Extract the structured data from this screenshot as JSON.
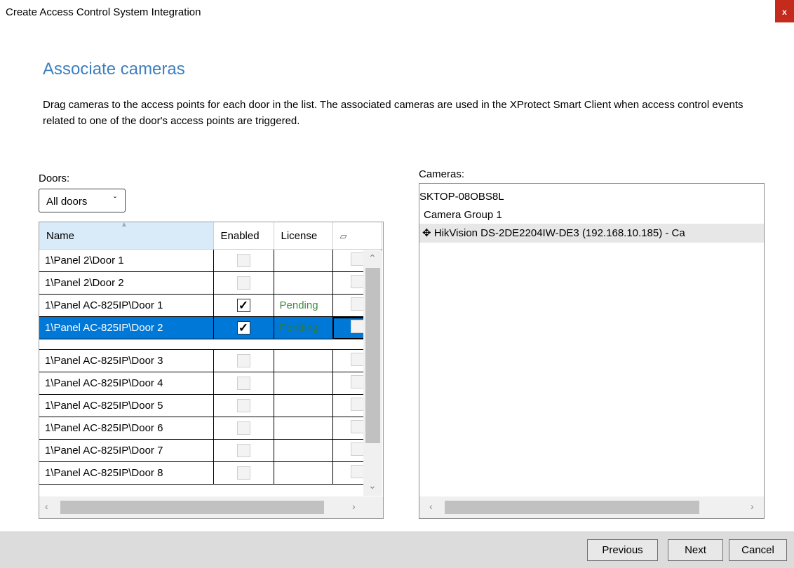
{
  "window": {
    "title": "Create Access Control System Integration",
    "close_label": "x"
  },
  "page": {
    "heading": "Associate cameras",
    "description": "Drag cameras to the access points for each door in the list. The associated cameras are used in the XProtect Smart Client when access control events related to one of the door's access points are triggered."
  },
  "doors": {
    "label": "Doors:",
    "filter": {
      "selected": "All doors"
    },
    "columns": [
      "Name",
      "Enabled",
      "License"
    ],
    "rows": [
      {
        "name": "1\\Panel 2\\Door 1",
        "enabled": false,
        "license": ""
      },
      {
        "name": "1\\Panel 2\\Door 2",
        "enabled": false,
        "license": ""
      },
      {
        "name": "1\\Panel AC-825IP\\Door 1",
        "enabled": true,
        "license": "Pending"
      },
      {
        "name": "1\\Panel AC-825IP\\Door 2",
        "enabled": true,
        "license": "Pending",
        "selected": true
      },
      {
        "name": "1\\Panel AC-825IP\\Door 3",
        "enabled": false,
        "license": ""
      },
      {
        "name": "1\\Panel AC-825IP\\Door 4",
        "enabled": false,
        "license": ""
      },
      {
        "name": "1\\Panel AC-825IP\\Door 5",
        "enabled": false,
        "license": ""
      },
      {
        "name": "1\\Panel AC-825IP\\Door 6",
        "enabled": false,
        "license": ""
      },
      {
        "name": "1\\Panel AC-825IP\\Door 7",
        "enabled": false,
        "license": ""
      },
      {
        "name": "1\\Panel AC-825IP\\Door 8",
        "enabled": false,
        "license": ""
      }
    ]
  },
  "cameras": {
    "label": "Cameras:",
    "tree": [
      {
        "text": "SKTOP-08OBS8L",
        "level": 0
      },
      {
        "text": "Camera Group 1",
        "level": 1
      },
      {
        "text": "HikVision DS-2DE2204IW-DE3 (192.168.10.185) - Ca",
        "level": 2,
        "icon": "ptz-camera-icon"
      }
    ]
  },
  "footer": {
    "previous": "Previous",
    "next": "Next",
    "cancel": "Cancel"
  },
  "colors": {
    "heading": "#3d7fbf",
    "selection": "#0078d7",
    "pending": "#3c8c3c",
    "close": "#c42b1c"
  }
}
